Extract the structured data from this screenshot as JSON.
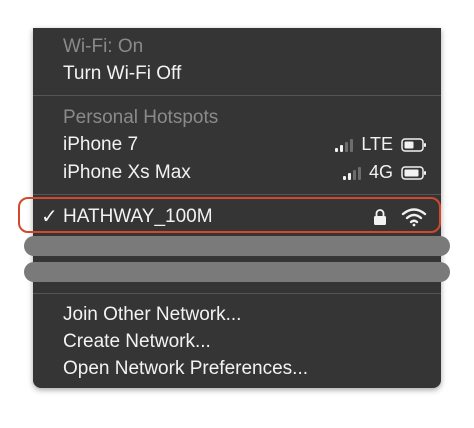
{
  "wifi": {
    "status": "Wi-Fi: On",
    "toggle_label": "Turn Wi-Fi Off"
  },
  "hotspots": {
    "header": "Personal Hotspots",
    "items": [
      {
        "name": "iPhone 7",
        "network_type": "LTE",
        "signal_bars": 2,
        "battery_icon": "battery-icon"
      },
      {
        "name": "iPhone Xs Max",
        "network_type": "4G",
        "signal_bars": 2,
        "battery_icon": "battery-icon"
      }
    ]
  },
  "networks": {
    "connected": {
      "name": "HATHWAY_100M",
      "checkmark": "✓",
      "secured": true,
      "icons": [
        "lock-icon",
        "wifi-icon"
      ]
    }
  },
  "actions": {
    "join_other": "Join Other Network...",
    "create_network": "Create Network...",
    "open_preferences": "Open Network Preferences..."
  },
  "colors": {
    "menu_background": "#353535",
    "highlight_outline": "#d2482b",
    "redaction": "#7a7a7a"
  }
}
